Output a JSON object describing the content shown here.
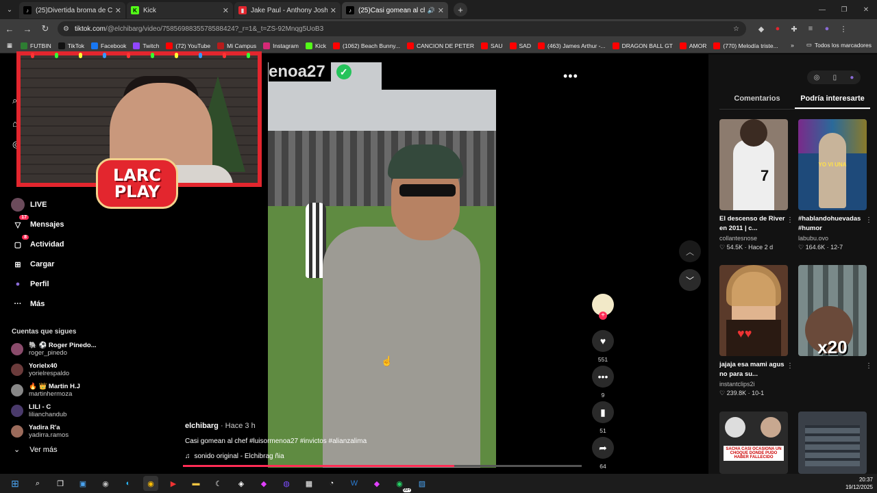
{
  "tabs": [
    {
      "title": "(25)Divertida broma de Coca C",
      "icon": "tiktok-icon",
      "close": "✕",
      "color": "#000000"
    },
    {
      "title": "Kick",
      "icon": "kick-icon",
      "close": "✕",
      "color": "#53fc18"
    },
    {
      "title": "Jake Paul - Anthony Joshua Bo",
      "icon": "bookmark-red-icon",
      "close": "✕",
      "color": "#e3262e"
    },
    {
      "title": "(25)Casi gomean al chef #lu",
      "icon": "tiktok-icon",
      "close": "✕",
      "color": "#000000",
      "audio": "🔊"
    }
  ],
  "new_tab_label": "+",
  "address": {
    "domain": "tiktok.com",
    "path": "/@elchibarg/video/7585698835578588424?_r=1&_t=ZS-92Mnqg5UoB3"
  },
  "bookmarks": [
    {
      "label": "FUTBIN",
      "color": "#2e7d32"
    },
    {
      "label": "TikTok",
      "color": "#111111"
    },
    {
      "label": "Facebook",
      "color": "#1877f2"
    },
    {
      "label": "Twitch",
      "color": "#9146ff"
    },
    {
      "label": "(72) YouTube",
      "color": "#ff0000"
    },
    {
      "label": "Mi Campus",
      "color": "#b71c1c"
    },
    {
      "label": "Instagram",
      "color": "#d62976"
    },
    {
      "label": "Kick",
      "color": "#53fc18"
    },
    {
      "label": "(1062) Beach Bunny...",
      "color": "#ff0000"
    },
    {
      "label": "CANCION DE PETER",
      "color": "#ff0000"
    },
    {
      "label": "SAU",
      "color": "#ff0000"
    },
    {
      "label": "SAD",
      "color": "#ff0000"
    },
    {
      "label": "(463) James Arthur -...",
      "color": "#ff0000"
    },
    {
      "label": "DRAGON BALL GT",
      "color": "#ff0000"
    },
    {
      "label": "AMOR",
      "color": "#ff0000"
    },
    {
      "label": "(770) Melodía triste...",
      "color": "#ff0000"
    }
  ],
  "bookmarks_more": "»",
  "bookmarks_all": "Todos los marcadores",
  "sidebar": {
    "items": [
      {
        "label": "LIVE",
        "icon": "live-icon"
      },
      {
        "label": "Mensajes",
        "icon": "messages-icon",
        "badge": "17"
      },
      {
        "label": "Actividad",
        "icon": "activity-icon",
        "badge": "8"
      },
      {
        "label": "Cargar",
        "icon": "upload-icon"
      },
      {
        "label": "Perfil",
        "icon": "profile-icon"
      },
      {
        "label": "Más",
        "icon": "more-icon"
      }
    ],
    "following_title": "Cuentas que sigues",
    "following": [
      {
        "name": "🐘 ⚽ Roger Pinedo...",
        "user": "roger_pinedo",
        "color": "#8a4b6b"
      },
      {
        "name": "Yorielx40",
        "user": "yorielrespaldo",
        "color": "#6b3b3b"
      },
      {
        "name": "🔥 👑 Martin H.J",
        "user": "martinhermoza",
        "color": "#888888"
      },
      {
        "name": "LILI - C",
        "user": "lilianchandub",
        "color": "#4a3a6b"
      },
      {
        "name": "Yadira R'a",
        "user": "yadirra.ramos",
        "color": "#9b6b5b"
      }
    ],
    "see_more": "Ver más"
  },
  "overlay": {
    "line1": "LARC",
    "line2": "PLAY"
  },
  "video": {
    "handle_overlay": "enoa27",
    "author": "elchibarg",
    "time": " · Hace 3 h",
    "description": "Casi gomean al chef #luisormenoa27  #invictos #alianzalima",
    "sound": "sonido original - Elchibrag ñia",
    "progress": 0.68
  },
  "actions": [
    {
      "icon": "heart-icon",
      "glyph": "♥",
      "count": "551"
    },
    {
      "icon": "comment-icon",
      "glyph": "•••",
      "count": "9"
    },
    {
      "icon": "bookmark-icon",
      "glyph": "▮",
      "count": "51"
    },
    {
      "icon": "share-icon",
      "glyph": "➦",
      "count": "64"
    }
  ],
  "right_panel": {
    "tabs": [
      "Comentarios",
      "Podría interesarte"
    ],
    "active_tab": 1,
    "cards": [
      {
        "title": "El descenso de River en 2011 | c...",
        "author": "collantesnose",
        "meta": "♡ 54.5K · Hace 2 d",
        "thumb_text": "",
        "color": "#8c7b6e"
      },
      {
        "title": "#hablandohuevadas #humor",
        "author": "labubu.ovo",
        "meta": "♡ 164.6K · 12-7",
        "thumb_text": "YO VI UNA",
        "color": "#1e4a7a"
      },
      {
        "title": "jajaja esa mami agus no para su...",
        "author": "instantclips2i",
        "meta": "♡ 239.8K · 10-1",
        "thumb_text": "",
        "color": "#5a3a2a"
      },
      {
        "title": "",
        "author": "",
        "meta": "",
        "thumb_text": "x20",
        "color": "#5c6a6a"
      }
    ],
    "bottom_cards": [
      {
        "thumb_text": "SACHA CASI OCASIONA UN CHOQUE DONDE PUDO HABER FALLECIDO",
        "color": "#2a2a2a"
      },
      {
        "thumb_text": "",
        "color": "#3a4048"
      }
    ]
  },
  "clock": {
    "time": "20:37",
    "date": "19/12/2025"
  },
  "taskbar_badge": "99+"
}
